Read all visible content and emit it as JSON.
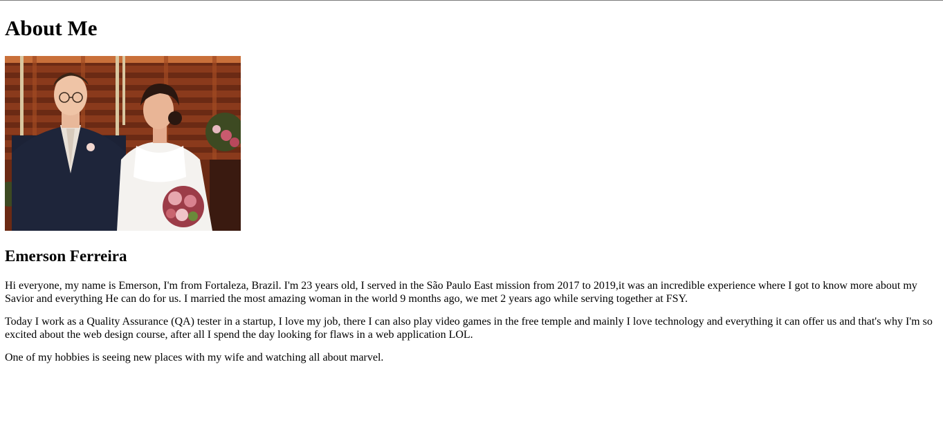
{
  "page": {
    "title": "About Me"
  },
  "photo": {
    "icon": "wedding-couple-photo",
    "alt": "Emerson and his wife at their wedding"
  },
  "profile": {
    "name": "Emerson Ferreira",
    "paragraphs": [
      "Hi everyone, my name is Emerson, I'm from Fortaleza, Brazil. I'm 23 years old, I served in the São Paulo East mission from 2017 to 2019,it was an incredible experience where I got to know more about my Savior and everything He can do for us. I married the most amazing woman in the world 9 months ago, we met 2 years ago while serving together at FSY.",
      "Today I work as a Quality Assurance (QA) tester in a startup, I love my job, there I can also play video games in the free temple and mainly I love technology and everything it can offer us and that's why I'm so excited about the web design course, after all I spend the day looking for flaws in a web application LOL.",
      "One of my hobbies is seeing new places with my wife and watching all about marvel."
    ]
  },
  "colors": {
    "text": "#000000",
    "background": "#ffffff",
    "top_rule": "#7a7a7a"
  }
}
